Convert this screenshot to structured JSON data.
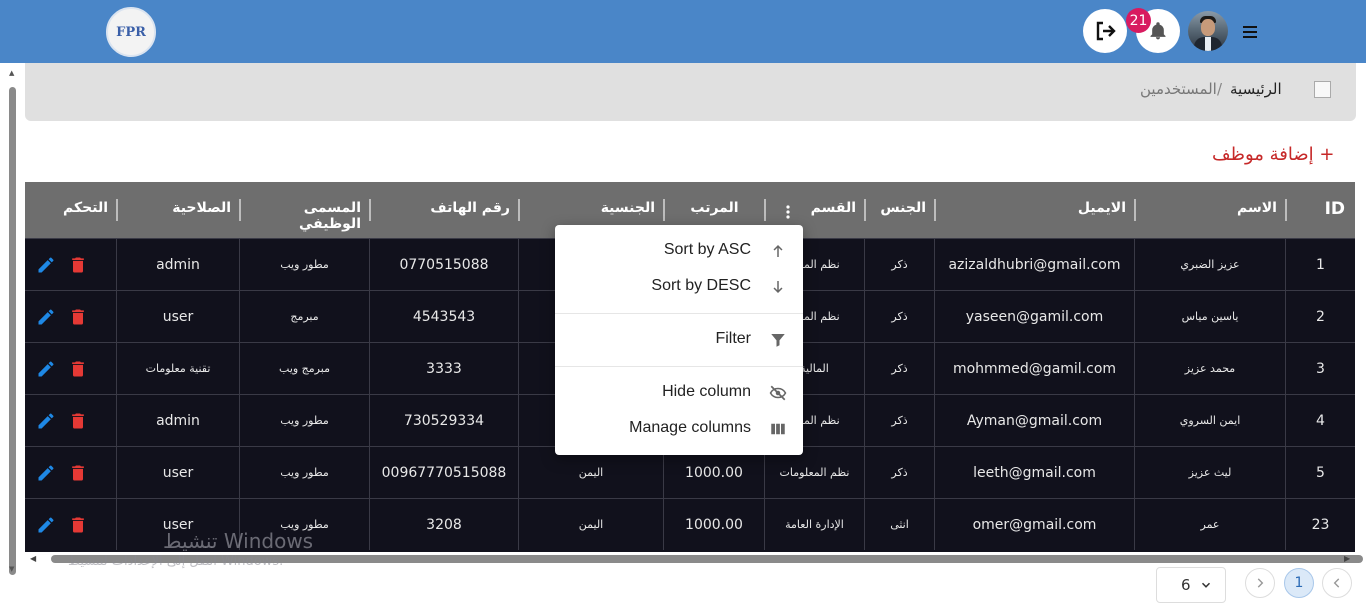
{
  "header": {
    "logo_text": "FPR",
    "notification_count": "21",
    "menu_icon": "hamburger-icon",
    "logout_icon": "logout-icon",
    "bell_icon": "bell-icon"
  },
  "breadcrumb": {
    "home": "الرئيسية",
    "separator": "/",
    "current": "المستخدمين"
  },
  "add_employee_label": "إضافة موظف +",
  "table": {
    "columns": [
      "ID",
      "الاسم",
      "الايميل",
      "الجنس",
      "القسم",
      "المرتب",
      "الجنسية",
      "رقم الهاتف",
      "المسمى الوظيفي",
      "الصلاحية",
      "التحكم"
    ],
    "rows": [
      {
        "id": "1",
        "name": "عزيز الضبري",
        "email": "azizaldhubri@gmail.com",
        "gender": "ذكر",
        "dept": "نظم المعلو",
        "salary": "",
        "nationality": "",
        "phone": "0770515088",
        "title": "مطور ويب",
        "role": "admin"
      },
      {
        "id": "2",
        "name": "ياسين مياس",
        "email": "yaseen@gamil.com",
        "gender": "ذكر",
        "dept": "نظم المعلو",
        "salary": "",
        "nationality": "",
        "phone": "4543543",
        "title": "مبرمج",
        "role": "user"
      },
      {
        "id": "3",
        "name": "محمد عزيز",
        "email": "mohmmed@gamil.com",
        "gender": "ذكر",
        "dept": "المالية",
        "salary": "",
        "nationality": "",
        "phone": "3333",
        "title": "مبرمج ويب",
        "role": "تقنية معلومات"
      },
      {
        "id": "4",
        "name": "ايمن السروي",
        "email": "Ayman@gmail.com",
        "gender": "ذكر",
        "dept": "نظم المعلو",
        "salary": "",
        "nationality": "",
        "phone": "730529334",
        "title": "مطور ويب",
        "role": "admin"
      },
      {
        "id": "5",
        "name": "ليث عزيز",
        "email": "leeth@gmail.com",
        "gender": "ذكر",
        "dept": "نظم المعلومات",
        "salary": "1000.00",
        "nationality": "اليمن",
        "phone": "00967770515088",
        "title": "مطور ويب",
        "role": "user"
      },
      {
        "id": "23",
        "name": "عمر",
        "email": "omer@gmail.com",
        "gender": "انثى",
        "dept": "الإدارة العامة",
        "salary": "1000.00",
        "nationality": "اليمن",
        "phone": "3208",
        "title": "مطور ويب",
        "role": "user"
      }
    ]
  },
  "column_menu": {
    "sort_asc": "Sort by ASC",
    "sort_desc": "Sort by DESC",
    "filter": "Filter",
    "hide_column": "Hide column",
    "manage_columns": "Manage columns"
  },
  "watermark": {
    "line1": "تنشيط Windows",
    "line2": "انتقل إلى الإعدادات لتنشيط Windows."
  },
  "pagination": {
    "rows_per_page": "6",
    "current_page": "1",
    "prev_icon": "chevron-left-icon",
    "next_icon": "chevron-right-icon"
  },
  "colors": {
    "topbar": "#4a86c8",
    "grid_bg": "#11111c",
    "header_bg": "#6e6e6e",
    "accent_red": "#c62828",
    "edit_blue": "#1e88e5",
    "delete_red": "#e53935",
    "badge": "#d81b60"
  }
}
